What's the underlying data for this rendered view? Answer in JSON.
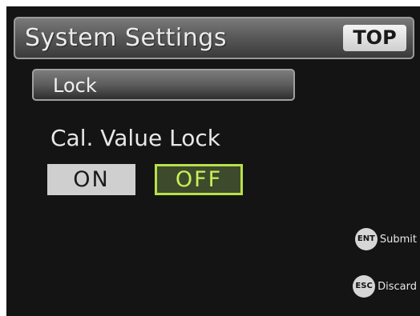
{
  "header": {
    "title": "System Settings",
    "top_button": "TOP"
  },
  "section": {
    "tab_label": "Lock"
  },
  "setting": {
    "label": "Cal. Value Lock",
    "options": [
      "ON",
      "OFF"
    ],
    "selected": "OFF"
  },
  "keys": {
    "submit": {
      "key": "ENT",
      "label": "Submit"
    },
    "discard": {
      "key": "ESC",
      "label": "Discard"
    }
  },
  "colors": {
    "background": "#141414",
    "selected_border": "#b8e04a",
    "selected_text": "#c8f05a"
  }
}
